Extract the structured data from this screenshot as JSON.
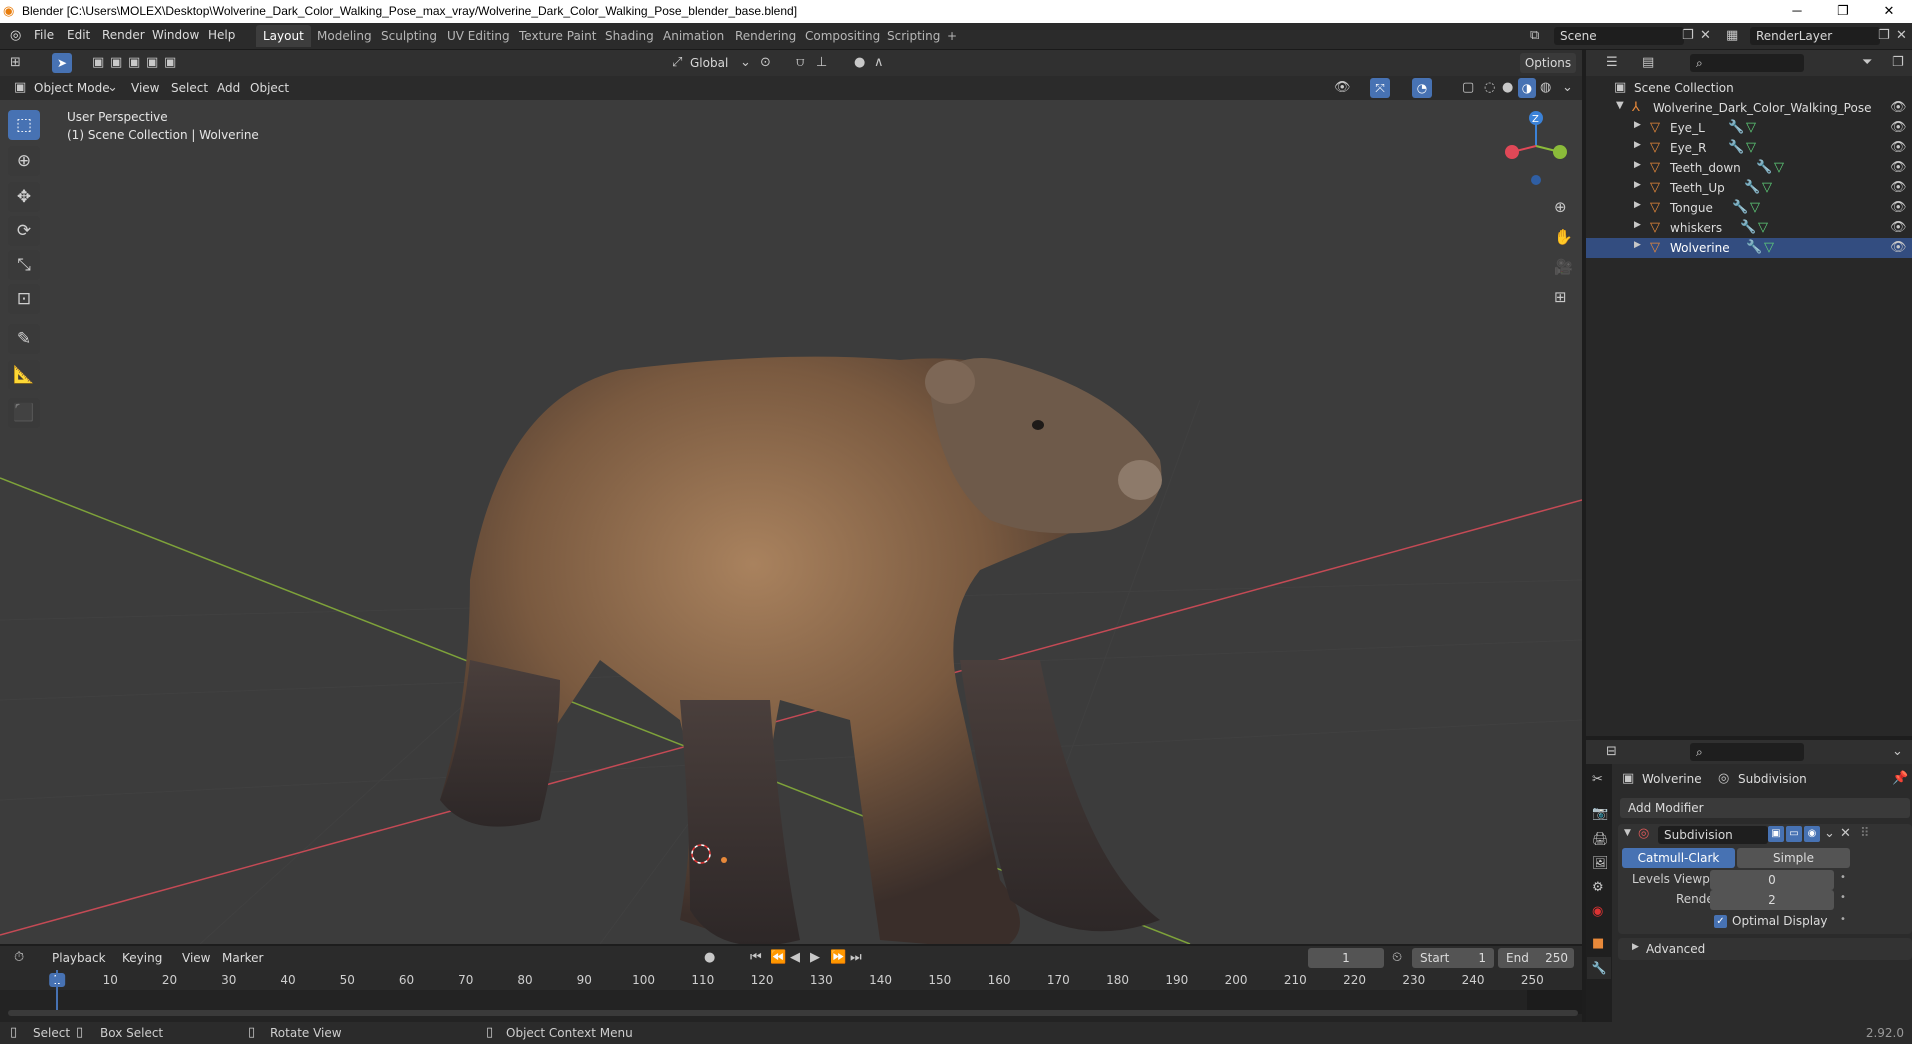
{
  "window": {
    "title": "Blender [C:\\Users\\MOLEX\\Desktop\\Wolverine_Dark_Color_Walking_Pose_max_vray/Wolverine_Dark_Color_Walking_Pose_blender_base.blend]",
    "minimize": "─",
    "maximize": "❐",
    "close": "✕"
  },
  "menu": [
    "File",
    "Edit",
    "Render",
    "Window",
    "Help"
  ],
  "workspaces": [
    "Layout",
    "Modeling",
    "Sculpting",
    "UV Editing",
    "Texture Paint",
    "Shading",
    "Animation",
    "Rendering",
    "Compositing",
    "Scripting"
  ],
  "active_workspace": "Layout",
  "add_workspace": "+",
  "scene": {
    "name": "Scene",
    "view_layer": "RenderLayer"
  },
  "viewport_header": {
    "transform_orientation": "Global",
    "options": "Options",
    "mode": "Object Mode",
    "menus": [
      "View",
      "Select",
      "Add",
      "Object"
    ]
  },
  "viewport": {
    "perspective": "User Perspective",
    "collection_info": "(1) Scene Collection | Wolverine",
    "gizmo_z": "Z"
  },
  "outliner": {
    "root": "Scene Collection",
    "collection": "Wolverine_Dark_Color_Walking_Pose",
    "objects": [
      "Eye_L",
      "Eye_R",
      "Teeth_down",
      "Teeth_Up",
      "Tongue",
      "whiskers",
      "Wolverine"
    ]
  },
  "properties": {
    "object": "Wolverine",
    "modifier_context": "Subdivision",
    "add_modifier": "Add Modifier",
    "modifier_name": "Subdivision",
    "mode_a": "Catmull-Clark",
    "mode_b": "Simple",
    "levels_viewport_label": "Levels Viewport",
    "levels_viewport_value": "0",
    "render_label": "Render",
    "render_value": "2",
    "optimal_display": "Optimal Display",
    "advanced": "Advanced"
  },
  "timeline": {
    "menus": [
      "Playback",
      "Keying",
      "View",
      "Marker"
    ],
    "current_frame": "1",
    "start_label": "Start",
    "start": "1",
    "end_label": "End",
    "end": "250",
    "ticks": [
      "1",
      "10",
      "20",
      "30",
      "40",
      "50",
      "60",
      "70",
      "80",
      "90",
      "100",
      "110",
      "120",
      "130",
      "140",
      "150",
      "160",
      "170",
      "180",
      "190",
      "200",
      "210",
      "220",
      "230",
      "240",
      "250"
    ]
  },
  "status": {
    "select": "Select",
    "box_select": "Box Select",
    "rotate_view": "Rotate View",
    "context_menu": "Object Context Menu",
    "version": "2.92.0"
  },
  "colors": {
    "accent": "#4772b3",
    "object_orange": "#e8893a",
    "axis_x": "#e04857",
    "axis_y": "#8bbb3a",
    "axis_z": "#3b82d8"
  }
}
